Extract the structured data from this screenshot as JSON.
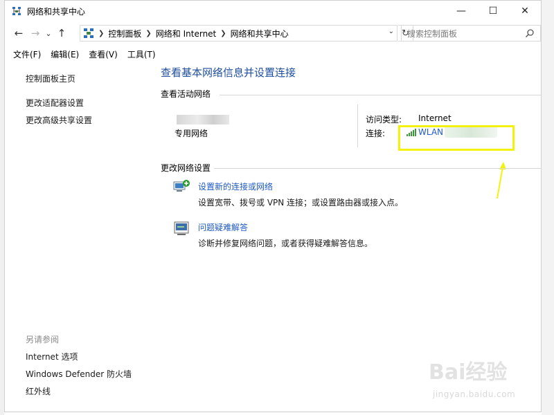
{
  "window": {
    "title": "网络和共享中心",
    "controls": {
      "minimize": "—",
      "maximize": "☐",
      "close": "✕"
    }
  },
  "nav": {
    "back": "←",
    "forward": "→",
    "recent": "⌄",
    "up": "↑",
    "breadcrumbs": [
      "控制面板",
      "网络和 Internet",
      "网络和共享中心"
    ],
    "refresh": "↻",
    "search_placeholder": "搜索控制面板"
  },
  "menu": [
    "文件(F)",
    "编辑(E)",
    "查看(V)",
    "工具(T)"
  ],
  "sidebar": {
    "links": [
      "控制面板主页",
      "更改适配器设置",
      "更改高级共享设置"
    ],
    "see_also_heading": "另请参阅",
    "see_also": [
      "Internet 选项",
      "Windows Defender 防火墙",
      "红外线"
    ]
  },
  "main": {
    "title": "查看基本网络信息并设置连接",
    "active_heading": "查看活动网络",
    "network_type": "专用网络",
    "access_label": "访问类型:",
    "access_value": "Internet",
    "connection_label": "连接:",
    "connection_value": "WLAN",
    "change_heading": "更改网络设置",
    "tasks": [
      {
        "title": "设置新的连接或网络",
        "desc": "设置宽带、拨号或 VPN 连接；或设置路由器或接入点。"
      },
      {
        "title": "问题疑难解答",
        "desc": "诊断并修复网络问题，或者获得疑难解答信息。"
      }
    ]
  },
  "watermark": {
    "main": "Bai经验",
    "sub": "jingyan.baidu.com"
  },
  "colors": {
    "link": "#1e5ac8",
    "title": "#1e4e9e",
    "highlight": "#f2f20a"
  }
}
